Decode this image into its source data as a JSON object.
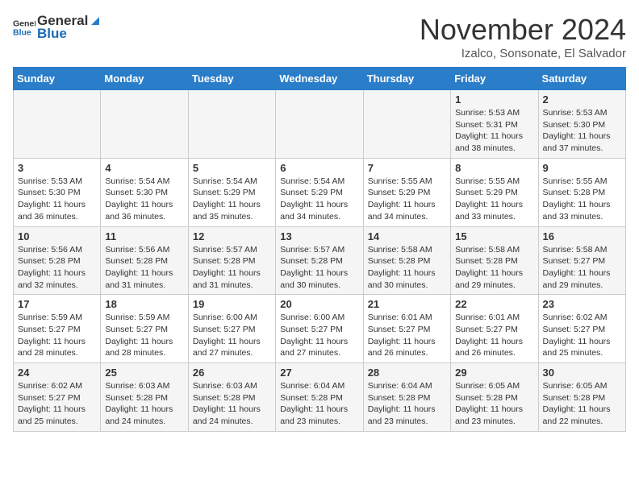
{
  "header": {
    "logo_general": "General",
    "logo_blue": "Blue",
    "month_title": "November 2024",
    "location": "Izalco, Sonsonate, El Salvador"
  },
  "days_of_week": [
    "Sunday",
    "Monday",
    "Tuesday",
    "Wednesday",
    "Thursday",
    "Friday",
    "Saturday"
  ],
  "weeks": [
    [
      {
        "num": "",
        "info": ""
      },
      {
        "num": "",
        "info": ""
      },
      {
        "num": "",
        "info": ""
      },
      {
        "num": "",
        "info": ""
      },
      {
        "num": "",
        "info": ""
      },
      {
        "num": "1",
        "info": "Sunrise: 5:53 AM\nSunset: 5:31 PM\nDaylight: 11 hours and 38 minutes."
      },
      {
        "num": "2",
        "info": "Sunrise: 5:53 AM\nSunset: 5:30 PM\nDaylight: 11 hours and 37 minutes."
      }
    ],
    [
      {
        "num": "3",
        "info": "Sunrise: 5:53 AM\nSunset: 5:30 PM\nDaylight: 11 hours and 36 minutes."
      },
      {
        "num": "4",
        "info": "Sunrise: 5:54 AM\nSunset: 5:30 PM\nDaylight: 11 hours and 36 minutes."
      },
      {
        "num": "5",
        "info": "Sunrise: 5:54 AM\nSunset: 5:29 PM\nDaylight: 11 hours and 35 minutes."
      },
      {
        "num": "6",
        "info": "Sunrise: 5:54 AM\nSunset: 5:29 PM\nDaylight: 11 hours and 34 minutes."
      },
      {
        "num": "7",
        "info": "Sunrise: 5:55 AM\nSunset: 5:29 PM\nDaylight: 11 hours and 34 minutes."
      },
      {
        "num": "8",
        "info": "Sunrise: 5:55 AM\nSunset: 5:29 PM\nDaylight: 11 hours and 33 minutes."
      },
      {
        "num": "9",
        "info": "Sunrise: 5:55 AM\nSunset: 5:28 PM\nDaylight: 11 hours and 33 minutes."
      }
    ],
    [
      {
        "num": "10",
        "info": "Sunrise: 5:56 AM\nSunset: 5:28 PM\nDaylight: 11 hours and 32 minutes."
      },
      {
        "num": "11",
        "info": "Sunrise: 5:56 AM\nSunset: 5:28 PM\nDaylight: 11 hours and 31 minutes."
      },
      {
        "num": "12",
        "info": "Sunrise: 5:57 AM\nSunset: 5:28 PM\nDaylight: 11 hours and 31 minutes."
      },
      {
        "num": "13",
        "info": "Sunrise: 5:57 AM\nSunset: 5:28 PM\nDaylight: 11 hours and 30 minutes."
      },
      {
        "num": "14",
        "info": "Sunrise: 5:58 AM\nSunset: 5:28 PM\nDaylight: 11 hours and 30 minutes."
      },
      {
        "num": "15",
        "info": "Sunrise: 5:58 AM\nSunset: 5:28 PM\nDaylight: 11 hours and 29 minutes."
      },
      {
        "num": "16",
        "info": "Sunrise: 5:58 AM\nSunset: 5:27 PM\nDaylight: 11 hours and 29 minutes."
      }
    ],
    [
      {
        "num": "17",
        "info": "Sunrise: 5:59 AM\nSunset: 5:27 PM\nDaylight: 11 hours and 28 minutes."
      },
      {
        "num": "18",
        "info": "Sunrise: 5:59 AM\nSunset: 5:27 PM\nDaylight: 11 hours and 28 minutes."
      },
      {
        "num": "19",
        "info": "Sunrise: 6:00 AM\nSunset: 5:27 PM\nDaylight: 11 hours and 27 minutes."
      },
      {
        "num": "20",
        "info": "Sunrise: 6:00 AM\nSunset: 5:27 PM\nDaylight: 11 hours and 27 minutes."
      },
      {
        "num": "21",
        "info": "Sunrise: 6:01 AM\nSunset: 5:27 PM\nDaylight: 11 hours and 26 minutes."
      },
      {
        "num": "22",
        "info": "Sunrise: 6:01 AM\nSunset: 5:27 PM\nDaylight: 11 hours and 26 minutes."
      },
      {
        "num": "23",
        "info": "Sunrise: 6:02 AM\nSunset: 5:27 PM\nDaylight: 11 hours and 25 minutes."
      }
    ],
    [
      {
        "num": "24",
        "info": "Sunrise: 6:02 AM\nSunset: 5:27 PM\nDaylight: 11 hours and 25 minutes."
      },
      {
        "num": "25",
        "info": "Sunrise: 6:03 AM\nSunset: 5:28 PM\nDaylight: 11 hours and 24 minutes."
      },
      {
        "num": "26",
        "info": "Sunrise: 6:03 AM\nSunset: 5:28 PM\nDaylight: 11 hours and 24 minutes."
      },
      {
        "num": "27",
        "info": "Sunrise: 6:04 AM\nSunset: 5:28 PM\nDaylight: 11 hours and 23 minutes."
      },
      {
        "num": "28",
        "info": "Sunrise: 6:04 AM\nSunset: 5:28 PM\nDaylight: 11 hours and 23 minutes."
      },
      {
        "num": "29",
        "info": "Sunrise: 6:05 AM\nSunset: 5:28 PM\nDaylight: 11 hours and 23 minutes."
      },
      {
        "num": "30",
        "info": "Sunrise: 6:05 AM\nSunset: 5:28 PM\nDaylight: 11 hours and 22 minutes."
      }
    ]
  ]
}
